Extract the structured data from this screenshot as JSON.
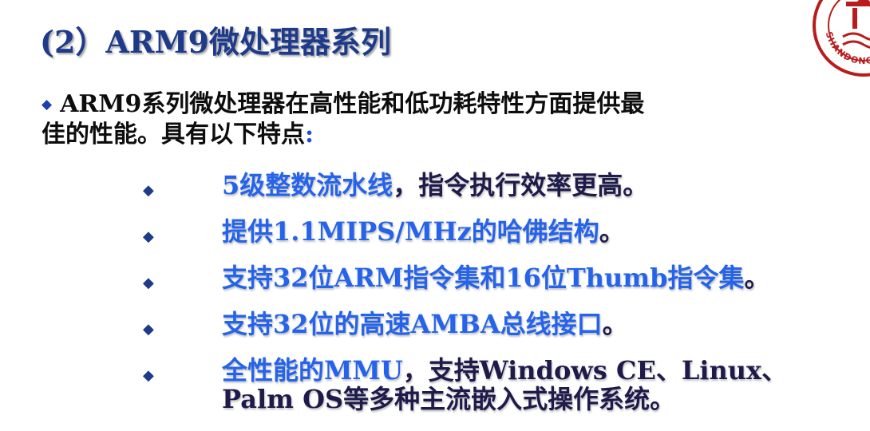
{
  "slide": {
    "title": "(2）ARM9微处理器系列",
    "intro": {
      "bullet": "◆",
      "line1": "ARM9系列微处理器在高性能和低功耗特性方面提供最",
      "line2": "佳的性能。具有以下特点",
      "colon": ":"
    },
    "bullet_glyph": "◆",
    "features": [
      {
        "blue": "5级整数流水线",
        "navy": "，指令执行效率更高。"
      },
      {
        "blue": "提供1.1MIPS/MHz的哈佛结构",
        "navy": "。"
      },
      {
        "blue": "支持32位ARM指令集和16位Thumb指令集",
        "navy": "。"
      },
      {
        "blue": "支持32位的高速AMBA总线接口",
        "navy": "。"
      },
      {
        "blue": "全性能的MMU",
        "navy": "，支持Windows CE、Linux、",
        "line2": "Palm OS等多种主流嵌入式操作系统。"
      }
    ],
    "logo": {
      "text": "SHANDONG",
      "icon": "university-seal-icon",
      "color": "#b91c1c"
    }
  },
  "colors": {
    "title": "#1e3a8a",
    "feature_blue": "#2563eb",
    "feature_navy": "#1e1b4b",
    "logo_red": "#b91c1c"
  }
}
